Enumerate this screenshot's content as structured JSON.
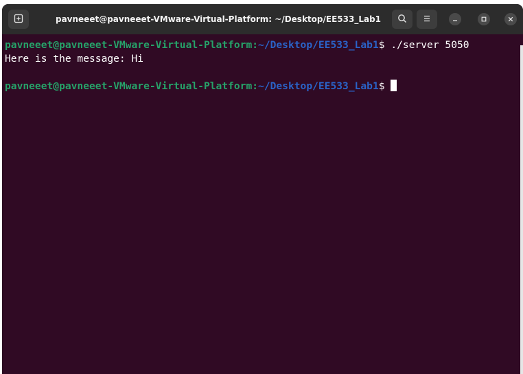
{
  "window": {
    "title": "pavneeet@pavneeet-VMware-Virtual-Platform: ~/Desktop/EE533_Lab1",
    "new_tab_icon": "new-tab-icon",
    "search_icon": "search-icon",
    "menu_icon": "hamburger-menu-icon",
    "minimize_icon": "minimize-icon",
    "maximize_icon": "maximize-icon",
    "close_icon": "close-icon"
  },
  "terminal": {
    "prompt_user": "pavneeet@pavneeet-VMware-Virtual-Platform",
    "prompt_sep": ":",
    "prompt_path": "~/Desktop/EE533_Lab1",
    "prompt_dollar": "$ ",
    "lines": [
      {
        "command": "./server 5050"
      },
      {
        "output": "Here is the message: Hi"
      },
      {
        "output": ""
      },
      {
        "command": ""
      }
    ]
  },
  "colors": {
    "background": "#300a24",
    "titlebar": "#2c2c2c",
    "user_green": "#26a269",
    "path_blue": "#2a63c8",
    "text": "#ffffff"
  }
}
